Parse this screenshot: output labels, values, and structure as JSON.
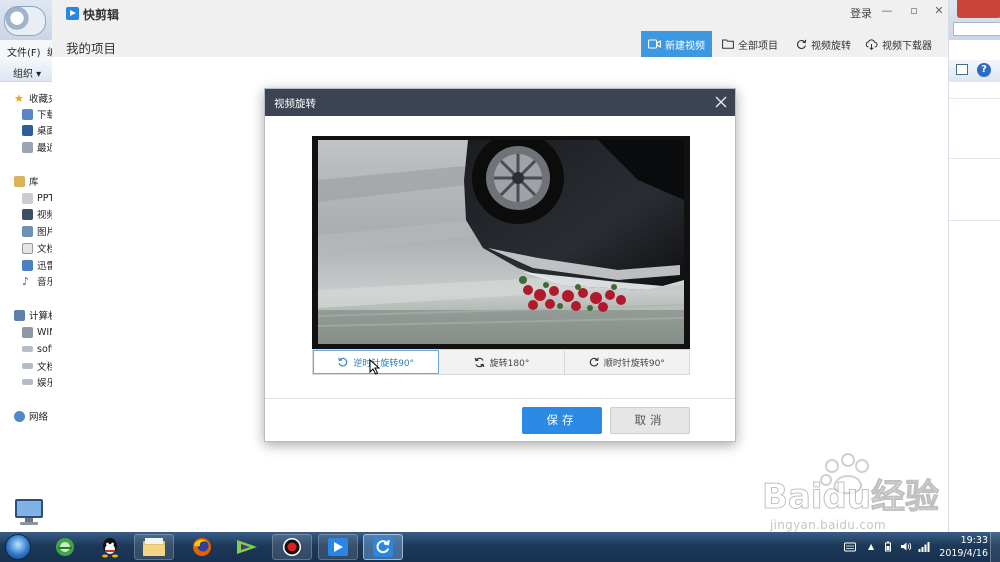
{
  "explorer": {
    "menu": {
      "file": "文件(F)",
      "edit_partial": "编"
    },
    "toolbar": {
      "organize": "组织 ▾"
    },
    "nav": {
      "favorites": "收藏夹",
      "downloads": "下载",
      "desktop": "桌面",
      "recent": "最近",
      "libraries": "库",
      "ppt": "PPT",
      "videos": "视频",
      "pictures": "图片",
      "documents": "文档",
      "xunlei": "迅雷",
      "music": "音乐",
      "computer": "计算机",
      "drive_win": "WIN",
      "drive_soft": "soft",
      "drive_doc": "文档",
      "drive_ent": "娱乐",
      "network": "网络"
    }
  },
  "app": {
    "name": "快剪辑",
    "login": "登录",
    "page_title": "我的项目",
    "nav": [
      {
        "label": "新建视频",
        "icon": "video-camera-icon",
        "active": true
      },
      {
        "label": "全部项目",
        "icon": "folder-icon",
        "active": false
      },
      {
        "label": "视频旋转",
        "icon": "rotate-icon",
        "active": false
      },
      {
        "label": "视频下载器",
        "icon": "download-cloud-icon",
        "active": false
      }
    ]
  },
  "dialog": {
    "title": "视频旋转",
    "rotate_options": [
      {
        "label": "逆时针旋转90°",
        "icon": "rotate-ccw-icon",
        "selected": true
      },
      {
        "label": "旋转180°",
        "icon": "rotate-180-icon",
        "selected": false
      },
      {
        "label": "顺时针旋转90°",
        "icon": "rotate-cw-icon",
        "selected": false
      }
    ],
    "save": "保存",
    "cancel": "取消"
  },
  "taskbar": {
    "apps": [
      "ie-icon",
      "qq-icon",
      "file-explorer-icon",
      "firefox-icon",
      "video-editor-icon",
      "screen-recorder-icon",
      "kuaijianji-icon",
      "video-rotate-icon"
    ],
    "time": "19:33",
    "date": "2019/4/16"
  },
  "watermark": {
    "brand": "Baidu经验",
    "url": "jingyan.baidu.com"
  },
  "colors": {
    "accent": "#3d98e0",
    "dialog_header": "#3c4352",
    "save_button": "#2b8ae3"
  }
}
